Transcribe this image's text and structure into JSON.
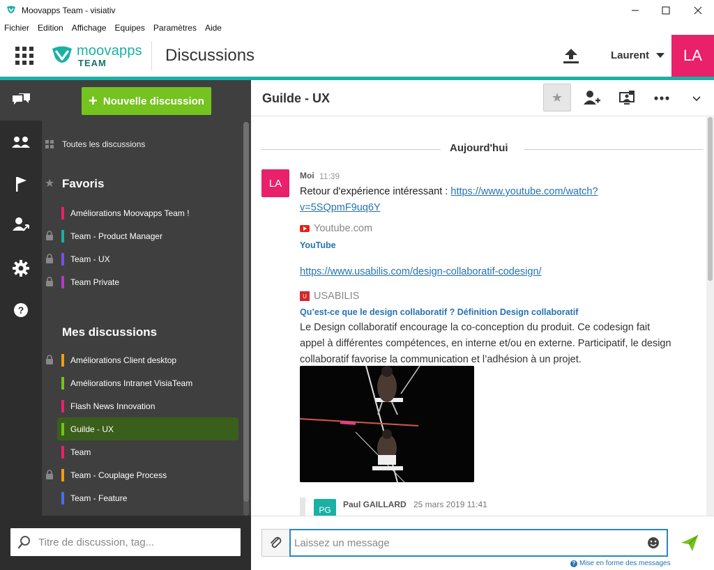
{
  "window": {
    "title": "Moovapps Team - visiativ"
  },
  "menu": [
    "Fichier",
    "Edition",
    "Affichage",
    "Equipes",
    "Paramètres",
    "Aide"
  ],
  "header": {
    "logo_word": "moovapps",
    "logo_sub": "TEAM",
    "page_title": "Discussions",
    "user_name": "Laurent",
    "user_initials": "LA",
    "accent_color": "#1ab0a4",
    "avatar_color": "#e8216a"
  },
  "sidebar": {
    "new_button": "Nouvelle discussion",
    "all_discussions": "Toutes les discussions",
    "favorites_title": "Favoris",
    "favorites": [
      {
        "label": "Améliorations Moovapps Team !",
        "color": "#e8216a",
        "locked": false
      },
      {
        "label": "Team - Product Manager",
        "color": "#1ab0a4",
        "locked": true
      },
      {
        "label": "Team - UX",
        "color": "#7b4ee3",
        "locked": true
      },
      {
        "label": "Team Private",
        "color": "#b03cc8",
        "locked": true
      }
    ],
    "mine_title": "Mes discussions",
    "mine": [
      {
        "label": "Améliorations Client desktop",
        "color": "#f39c12",
        "locked": true
      },
      {
        "label": "Améliorations Intranet VisiaTeam",
        "color": "#75c31e",
        "locked": false
      },
      {
        "label": "Flash News Innovation",
        "color": "#e8216a",
        "locked": false
      },
      {
        "label": "Guilde - UX",
        "color": "#75c31e",
        "locked": false,
        "selected": true
      },
      {
        "label": "Team",
        "color": "#e8216a",
        "locked": false
      },
      {
        "label": "Team - Couplage Process",
        "color": "#f39c12",
        "locked": true
      },
      {
        "label": "Team - Feature",
        "color": "#4a6cf0",
        "locked": false
      }
    ],
    "search_placeholder": "Titre de discussion, tag..."
  },
  "conversation": {
    "title": "Guilde - UX",
    "day_separator": "Aujourd'hui",
    "message": {
      "initials": "LA",
      "author": "Moi",
      "time": "11:39",
      "text": "Retour d'expérience intéressant : ",
      "link1": "https://www.youtube.com/watch?v=5SQpmF9uq6Y",
      "preview1_source": "Youtube.com",
      "preview1_title": "YouTube",
      "link2": "https://www.usabilis.com/design-collaboratif-codesign/",
      "preview2_source": "USABILIS",
      "preview2_title": "Qu’est-ce que le design collaboratif ? Définition Design collaboratif",
      "preview2_desc": "Le Design collaboratif encourage la co-conception du produit. Ce codesign fait appel à différentes compétences, en interne et/ou en externe. Participatif, le design collaboratif favorise la communication et l’adhésion à un projet."
    },
    "quoted": {
      "initials": "PG",
      "author": "Paul GAILLARD",
      "time": "25 mars 2019 11:41"
    }
  },
  "composer": {
    "placeholder": "Laissez un message",
    "format_help": "Mise en forme des messages"
  }
}
